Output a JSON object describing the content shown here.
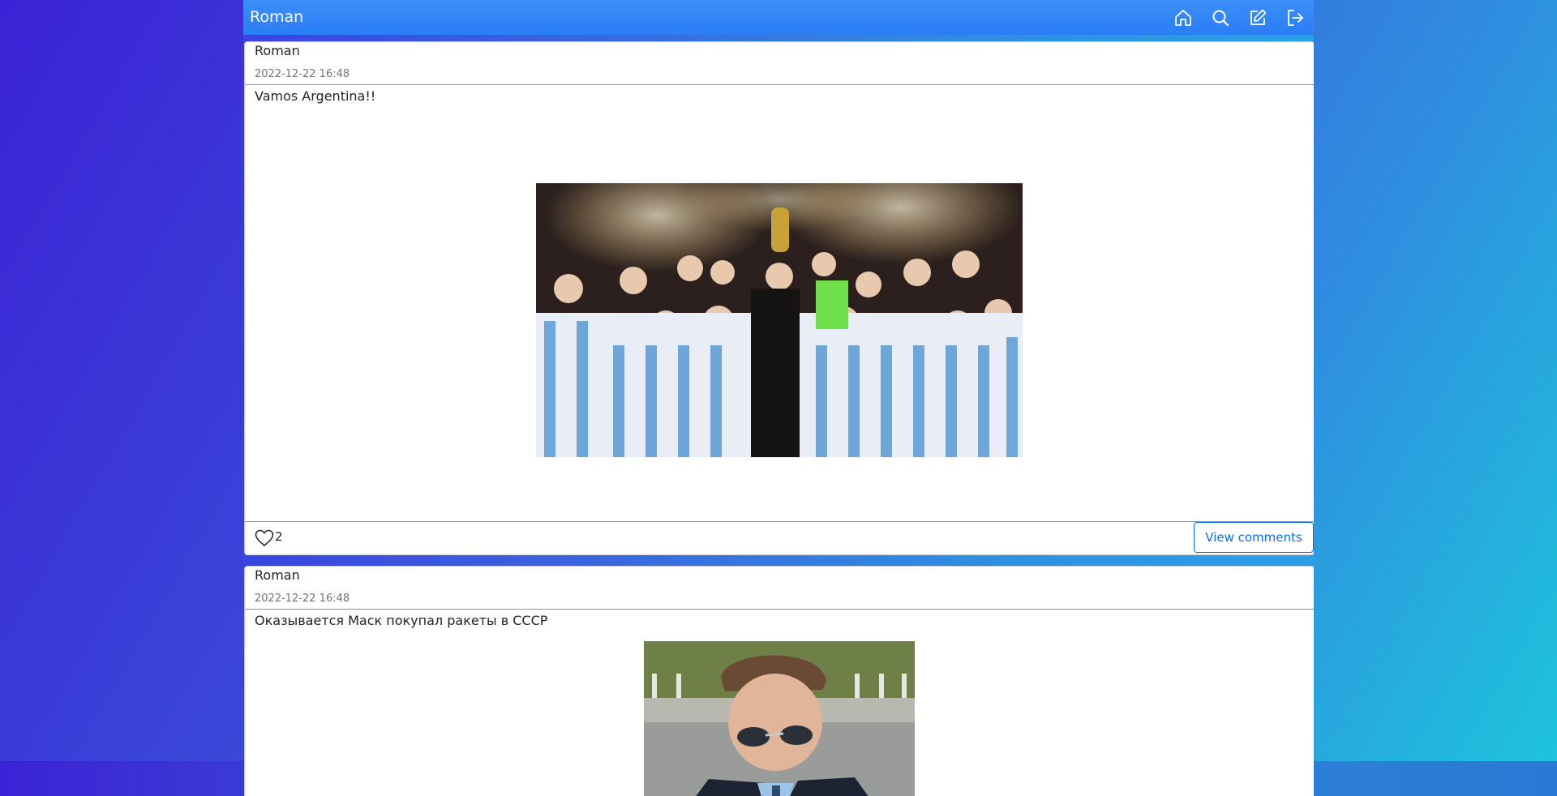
{
  "navbar": {
    "brand": "Roman",
    "icons": [
      "home-icon",
      "search-icon",
      "edit-icon",
      "logout-icon"
    ]
  },
  "posts": [
    {
      "author": "Roman",
      "timestamp": "2022-12-22 16:48",
      "text": "Vamos Argentina!!",
      "likes": "2",
      "comments_button": "View comments",
      "image": "team-celebration-photo"
    },
    {
      "author": "Roman",
      "timestamp": "2022-12-22 16:48",
      "text": "Оказывается Маск покупал ракеты в СССР",
      "image": "man-in-suit-photo"
    }
  ],
  "colors": {
    "navbar": "#2b7df5",
    "accent": "#0d6efd"
  }
}
